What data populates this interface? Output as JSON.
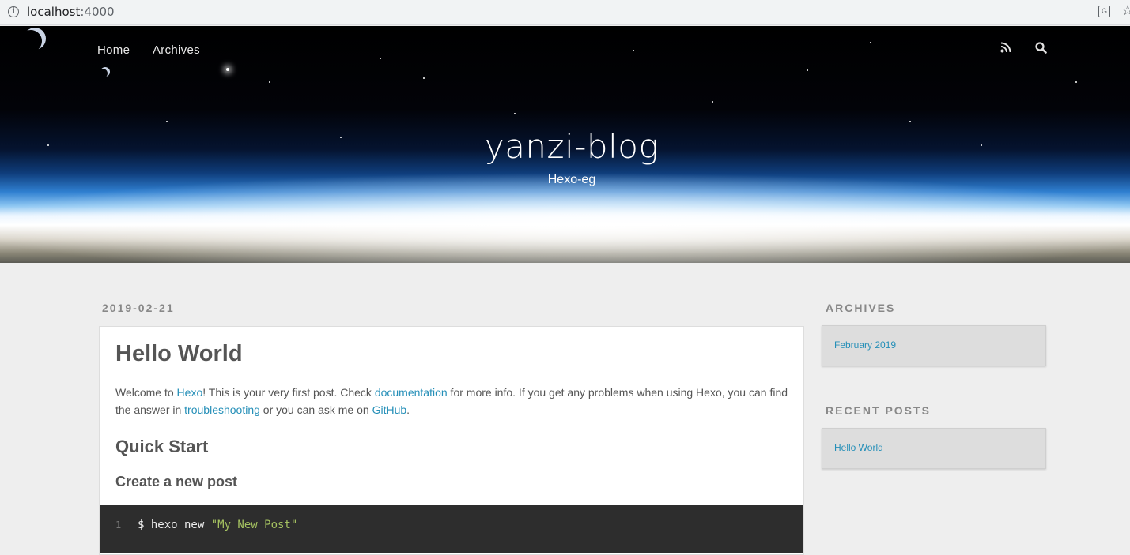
{
  "browser": {
    "url_host": "localhost",
    "url_port": ":4000",
    "icons": [
      "info-icon",
      "translate-icon",
      "bookmark-star-icon"
    ]
  },
  "header": {
    "nav": [
      {
        "label": "Home"
      },
      {
        "label": "Archives"
      }
    ],
    "icons": [
      "rss-icon",
      "search-icon"
    ],
    "title": "yanzi-blog",
    "subtitle": "Hexo-eg"
  },
  "post": {
    "date": "2019-02-21",
    "title": "Hello World",
    "intro": {
      "t1": "Welcome to ",
      "link_hexo": "Hexo",
      "t2": "! This is your very first post. Check ",
      "link_docs": "documentation",
      "t3": " for more info. If you get any problems when using Hexo, you can find the answer in ",
      "link_troubleshooting": "troubleshooting",
      "t4": " or you can ask me on ",
      "link_github": "GitHub",
      "t5": "."
    },
    "heading_quick_start": "Quick Start",
    "heading_create_post": "Create a new post",
    "code": {
      "line_number": "1",
      "command": "$ hexo new ",
      "argument": "\"My New Post\""
    }
  },
  "sidebar": {
    "archives_title": "ARCHIVES",
    "archives_items": [
      "February 2019"
    ],
    "recent_posts_title": "RECENT POSTS",
    "recent_posts_items": [
      "Hello World"
    ]
  },
  "colors": {
    "link": "#258fb8",
    "page_bg": "#eeeeee",
    "code_bg": "#2d2d2d"
  }
}
